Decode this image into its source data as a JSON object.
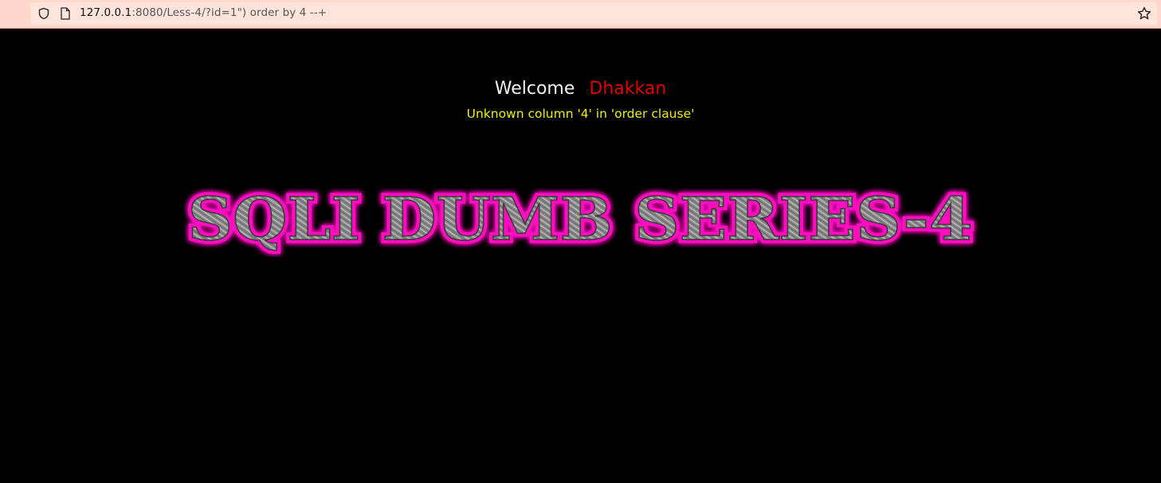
{
  "browser": {
    "url_host": "127.0.0.1",
    "url_rest": ":8080/Less-4/?id=1\") order by 4 --+",
    "icons": [
      "shield-icon",
      "page-icon",
      "star-icon"
    ]
  },
  "page": {
    "welcome_label": "Welcome",
    "user_name": "Dhakkan",
    "error_message": "Unknown column '4' in 'order clause'",
    "banner_text": "SQLI DUMB SERIES-4",
    "colors": {
      "background": "#000000",
      "welcome": "#f2f2f2",
      "name": "#e00000",
      "error": "#f0f000",
      "banner_glow": "#ff10c0"
    }
  }
}
